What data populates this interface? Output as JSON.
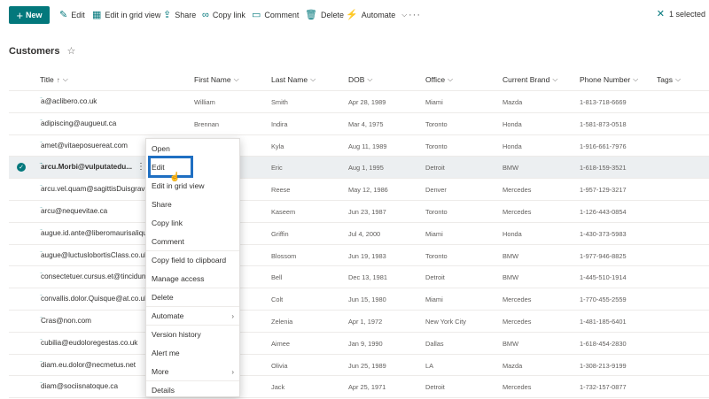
{
  "command_bar": {
    "new_label": "New",
    "items": [
      {
        "label": "Edit",
        "icon": "pencil-icon"
      },
      {
        "label": "Edit in grid view",
        "icon": "grid-icon"
      },
      {
        "label": "Share",
        "icon": "share-icon"
      },
      {
        "label": "Copy link",
        "icon": "link-icon"
      },
      {
        "label": "Comment",
        "icon": "comment-icon"
      },
      {
        "label": "Delete",
        "icon": "trash-icon"
      },
      {
        "label": "Automate",
        "icon": "automate-icon"
      }
    ],
    "selected_text": "1 selected"
  },
  "list": {
    "title": "Customers"
  },
  "columns": {
    "title": "Title",
    "first": "First Name",
    "last": "Last Name",
    "dob": "DOB",
    "office": "Office",
    "brand": "Current Brand",
    "phone": "Phone Number",
    "tags": "Tags"
  },
  "rows": [
    {
      "title": "a@aclibero.co.uk",
      "first": "William",
      "last": "Smith",
      "dob": "Apr 28, 1989",
      "office": "Miami",
      "brand": "Mazda",
      "phone": "1-813-718-6669"
    },
    {
      "title": "adipiscing@augueut.ca",
      "first": "Brennan",
      "last": "Indira",
      "dob": "Mar 4, 1975",
      "office": "Toronto",
      "brand": "Honda",
      "phone": "1-581-873-0518"
    },
    {
      "title": "amet@vitaeposuereat.com",
      "first": "",
      "last": "Kyla",
      "dob": "Aug 11, 1989",
      "office": "Toronto",
      "brand": "Honda",
      "phone": "1-916-661-7976"
    },
    {
      "title": "arcu.Morbi@vulputatedu...",
      "first": "",
      "last": "Eric",
      "dob": "Aug 1, 1995",
      "office": "Detroit",
      "brand": "BMW",
      "phone": "1-618-159-3521"
    },
    {
      "title": "arcu.vel.quam@sagittisDuisgravida",
      "first": "",
      "last": "Reese",
      "dob": "May 12, 1986",
      "office": "Denver",
      "brand": "Mercedes",
      "phone": "1-957-129-3217"
    },
    {
      "title": "arcu@nequevitae.ca",
      "first": "",
      "last": "Kaseem",
      "dob": "Jun 23, 1987",
      "office": "Toronto",
      "brand": "Mercedes",
      "phone": "1-126-443-0854"
    },
    {
      "title": "augue.id.ante@liberomaurisaliquam",
      "first": "",
      "last": "Griffin",
      "dob": "Jul 4, 2000",
      "office": "Miami",
      "brand": "Honda",
      "phone": "1-430-373-5983"
    },
    {
      "title": "augue@luctuslobortisClass.co.uk",
      "first": "",
      "last": "Blossom",
      "dob": "Jun 19, 1983",
      "office": "Toronto",
      "brand": "BMW",
      "phone": "1-977-946-8825"
    },
    {
      "title": "consectetuer.cursus.et@tinciduntD",
      "first": "",
      "last": "Bell",
      "dob": "Dec 13, 1981",
      "office": "Detroit",
      "brand": "BMW",
      "phone": "1-445-510-1914"
    },
    {
      "title": "convallis.dolor.Quisque@at.co.uk",
      "first": "",
      "last": "Colt",
      "dob": "Jun 15, 1980",
      "office": "Miami",
      "brand": "Mercedes",
      "phone": "1-770-455-2559"
    },
    {
      "title": "Cras@non.com",
      "first": "",
      "last": "Zelenia",
      "dob": "Apr 1, 1972",
      "office": "New York City",
      "brand": "Mercedes",
      "phone": "1-481-185-6401"
    },
    {
      "title": "cubilia@eudoloregestas.co.uk",
      "first": "",
      "last": "Aimee",
      "dob": "Jan 9, 1990",
      "office": "Dallas",
      "brand": "BMW",
      "phone": "1-618-454-2830"
    },
    {
      "title": "diam.eu.dolor@necmetus.net",
      "first": "",
      "last": "Olivia",
      "dob": "Jun 25, 1989",
      "office": "LA",
      "brand": "Mazda",
      "phone": "1-308-213-9199"
    },
    {
      "title": "diam@sociisnatoque.ca",
      "first": "",
      "last": "Jack",
      "dob": "Apr 25, 1971",
      "office": "Detroit",
      "brand": "Mercedes",
      "phone": "1-732-157-0877"
    }
  ],
  "context_menu": {
    "items": [
      "Open",
      "Edit",
      "Edit in grid view",
      "Share",
      "Copy link",
      "Comment",
      "Copy field to clipboard",
      "Manage access",
      "Delete",
      "Automate",
      "Version history",
      "Alert me",
      "More",
      "Details"
    ]
  },
  "colors": {
    "accent": "#03787c",
    "highlight_border": "#1f6fc2",
    "selected_row": "#eceff1"
  }
}
